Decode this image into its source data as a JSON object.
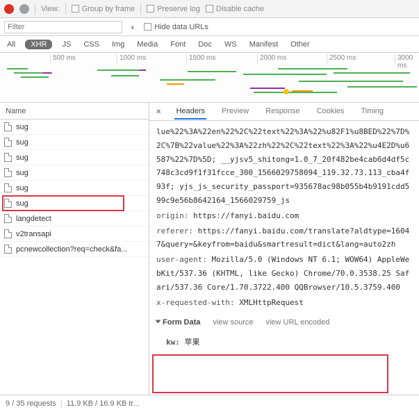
{
  "toolbar": {
    "view_label": "View:",
    "group_by_frame": "Group by frame",
    "preserve_log": "Preserve log",
    "disable_cache": "Disable cache"
  },
  "filter": {
    "placeholder": "Filter",
    "hide_data_urls": "Hide data URLs"
  },
  "type_tabs": [
    "All",
    "XHR",
    "JS",
    "CSS",
    "Img",
    "Media",
    "Font",
    "Doc",
    "WS",
    "Manifest",
    "Other"
  ],
  "type_active_index": 1,
  "timeline_ticks": [
    {
      "label": "500 ms",
      "pos": 72
    },
    {
      "label": "1000 ms",
      "pos": 168
    },
    {
      "label": "1500 ms",
      "pos": 268
    },
    {
      "label": "2000 ms",
      "pos": 370
    },
    {
      "label": "2500 ms",
      "pos": 470
    },
    {
      "label": "3000 ms",
      "pos": 568
    }
  ],
  "left": {
    "header": "Name",
    "requests": [
      {
        "name": "sug"
      },
      {
        "name": "sug"
      },
      {
        "name": "sug"
      },
      {
        "name": "sug"
      },
      {
        "name": "sug"
      },
      {
        "name": "sug"
      },
      {
        "name": "langdetect"
      },
      {
        "name": "v2transapi"
      },
      {
        "name": "pcnewcollection?req=check&fa..."
      }
    ],
    "highlight_index": 5
  },
  "detail": {
    "tabs": [
      "Headers",
      "Preview",
      "Response",
      "Cookies",
      "Timing"
    ],
    "active_index": 0,
    "continuation": "lue%22%3A%22en%22%2C%22text%22%3A%22%u82F1%u8BED%22%7D%2C%7B%22value%22%3A%22zh%22%2C%22text%22%3A%22%u4E2D%u6587%22%7D%5D; __yjsv5_shitong=1.0_7_20f482be4cab6d4df5c748c3cd9f1f31fcce_300_1566029758094_119.32.73.113_cba4f93f; yjs_js_security_passport=935678ac98b055b4b9191cdd599c9e56b8642164_1566029759_js",
    "headers": [
      {
        "k": "origin",
        "v": "https://fanyi.baidu.com"
      },
      {
        "k": "referer",
        "v": "https://fanyi.baidu.com/translate?aldtype=16047&query=&keyfrom=baidu&smartresult=dict&lang=auto2zh"
      },
      {
        "k": "user-agent",
        "v": "Mozilla/5.0 (Windows NT 6.1; WOW64) AppleWebKit/537.36 (KHTML, like Gecko) Chrome/70.0.3538.25 Safari/537.36 Core/1.70.3722.400 QQBrowser/10.5.3759.400"
      },
      {
        "k": "x-requested-with",
        "v": "XMLHttpRequest"
      }
    ],
    "form_section": {
      "title": "Form Data",
      "view_source": "view source",
      "view_url_encoded": "view URL encoded",
      "kv_key": "kw:",
      "kv_val": "苹果"
    }
  },
  "status": {
    "requests": "9 / 35 requests",
    "transferred": "11.9 KB / 16.9 KB tr..."
  }
}
